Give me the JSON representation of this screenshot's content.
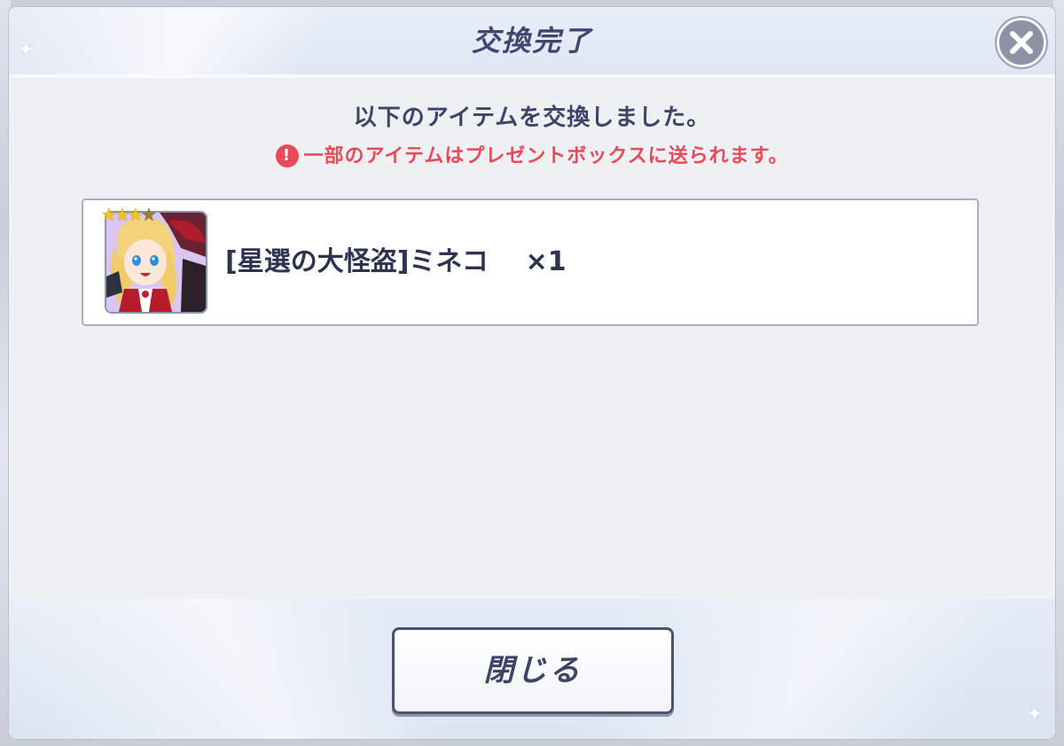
{
  "dialog": {
    "title": "交換完了",
    "message": "以下のアイテムを交換しました。",
    "warning": "一部のアイテムはプレゼントボックスに送られます。",
    "warning_icon": "!",
    "close_icon_name": "close-x-icon",
    "item": {
      "name": "[星選の大怪盗]ミネコ",
      "quantity": "×1",
      "rarity_filled": 3,
      "rarity_total": 4
    },
    "close_button_label": "閉じる"
  },
  "colors": {
    "title": "#3e4770",
    "warning": "#ea4a57",
    "button_border": "#4a5272"
  }
}
